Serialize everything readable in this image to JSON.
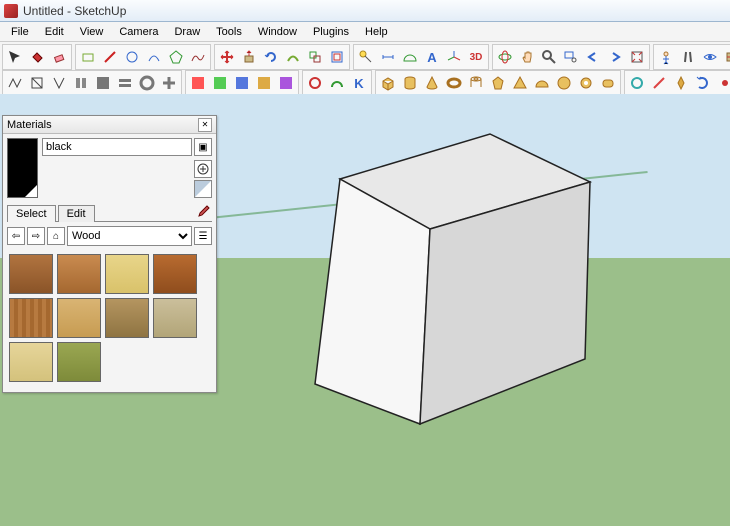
{
  "window": {
    "title": "Untitled - SketchUp"
  },
  "menu": [
    "File",
    "Edit",
    "View",
    "Camera",
    "Draw",
    "Tools",
    "Window",
    "Plugins",
    "Help"
  ],
  "materials": {
    "panel_title": "Materials",
    "current_name": "black",
    "tabs": {
      "select": "Select",
      "edit": "Edit"
    },
    "category": "Wood",
    "swatches": [
      "wood-cherry",
      "wood-oak",
      "wood-pine",
      "wood-mahogany",
      "wood-parquet",
      "wood-maple",
      "wood-walnut",
      "wood-ash",
      "wood-birch",
      "wood-bamboo"
    ]
  }
}
